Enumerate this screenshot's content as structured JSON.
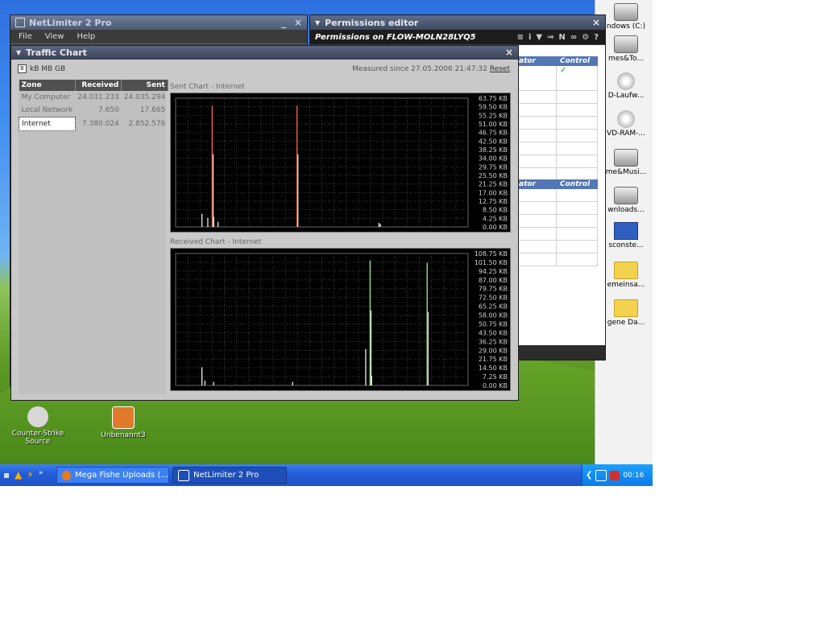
{
  "desktop": {
    "icons": [
      {
        "label": "Counter-Strike Source",
        "color": "#d8d8d8"
      },
      {
        "label": "Unbenannt3",
        "color": "#e07a2a"
      }
    ],
    "right_icons": [
      {
        "label": "ndows (C:)",
        "kind": "drive"
      },
      {
        "label": "mes&To...",
        "kind": "drive"
      },
      {
        "label": "D-Laufw...",
        "kind": "cd"
      },
      {
        "label": "VD-RAM-...",
        "kind": "cd"
      },
      {
        "label": "me&Musi...",
        "kind": "drive"
      },
      {
        "label": "wnloads...",
        "kind": "drive"
      },
      {
        "label": "sconste...",
        "kind": "check"
      },
      {
        "label": "emeinsa...",
        "kind": "folder"
      },
      {
        "label": "gene Da...",
        "kind": "folder"
      }
    ]
  },
  "netlimiter": {
    "title": "NetLimiter 2 Pro",
    "close": "×",
    "minimize": "_",
    "menu": [
      "File",
      "View",
      "Help"
    ]
  },
  "permissions": {
    "title": "Permissions editor",
    "subtitle": "Permissions on FLOW-MOLN28LYQ5",
    "close": "×",
    "tools": [
      "≡",
      "i",
      "▼",
      "⇒",
      "N",
      "∞",
      "⚙",
      "?"
    ],
    "col1": "ator",
    "col2": "Control",
    "check": "✓"
  },
  "traffic": {
    "title": "Traffic Chart",
    "close": "×",
    "units": {
      "box": "B",
      "rest": "kB MB GB"
    },
    "measured": "Measured since 27.05.2006 21:47:32",
    "reset": "Reset",
    "columns": [
      "Zone",
      "Received",
      "Sent"
    ],
    "rows": [
      {
        "zone": "My Computer",
        "received": "24.031.233",
        "sent": "24.035.294"
      },
      {
        "zone": "Local Network",
        "received": "7.650",
        "sent": "17.665"
      },
      {
        "zone": "Internet",
        "received": "7.380.024",
        "sent": "2.852.576"
      }
    ]
  },
  "chart_data": [
    {
      "type": "bar",
      "title": "Sent Chart - Internet",
      "y_ticks": [
        "63.75 KB",
        "59.50 KB",
        "55.25 KB",
        "51.00 KB",
        "46.75 KB",
        "42.50 KB",
        "38.25 KB",
        "34.00 KB",
        "29.75 KB",
        "25.50 KB",
        "21.25 KB",
        "17.00 KB",
        "12.75 KB",
        "8.50 KB",
        "4.25 KB",
        "0.00 KB"
      ],
      "ylim": [
        0,
        63.75
      ],
      "grid": true,
      "color": "#e06040",
      "values": [
        {
          "x": 0.09,
          "y": 6.5
        },
        {
          "x": 0.11,
          "y": 4.5
        },
        {
          "x": 0.125,
          "y": 60.0
        },
        {
          "x": 0.13,
          "y": 5.0
        },
        {
          "x": 0.145,
          "y": 2.5
        },
        {
          "x": 0.415,
          "y": 60.0
        },
        {
          "x": 0.695,
          "y": 2.0
        },
        {
          "x": 0.7,
          "y": 1.5
        }
      ]
    },
    {
      "type": "bar",
      "title": "Received Chart - Internet",
      "y_ticks": [
        "108.75 KB",
        "101.50 KB",
        "94.25 KB",
        "87.00 KB",
        "79.75 KB",
        "72.50 KB",
        "65.25 KB",
        "58.00 KB",
        "50.75 KB",
        "43.50 KB",
        "36.25 KB",
        "29.00 KB",
        "21.75 KB",
        "14.50 KB",
        "7.25 KB",
        "0.00 KB"
      ],
      "ylim": [
        0,
        108.75
      ],
      "grid": true,
      "color": "#8fd080",
      "values": [
        {
          "x": 0.09,
          "y": 15.0
        },
        {
          "x": 0.1,
          "y": 4.0
        },
        {
          "x": 0.13,
          "y": 3.0
        },
        {
          "x": 0.4,
          "y": 3.0
        },
        {
          "x": 0.65,
          "y": 30.0
        },
        {
          "x": 0.665,
          "y": 103.0
        },
        {
          "x": 0.67,
          "y": 8.0
        },
        {
          "x": 0.86,
          "y": 101.0
        }
      ]
    }
  ],
  "taskbar": {
    "buttons": [
      {
        "label": "Mega Fishe Uploads (...",
        "active": false
      },
      {
        "label": "NetLimiter 2 Pro",
        "active": true
      }
    ],
    "clock": "00:16"
  }
}
